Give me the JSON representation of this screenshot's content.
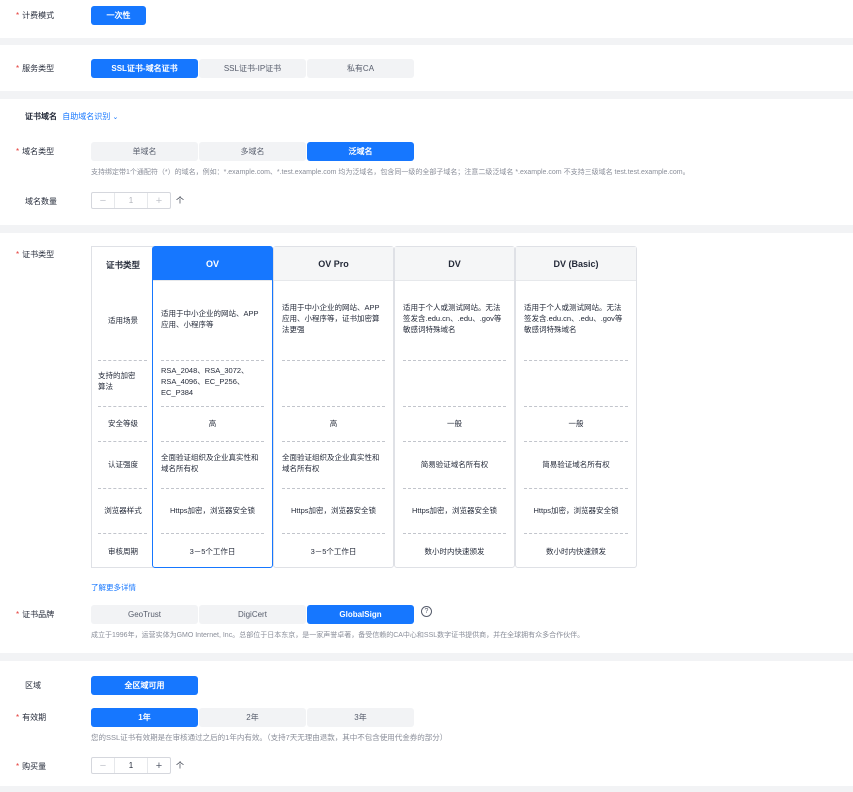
{
  "billing": {
    "label": "计费模式",
    "options": [
      "一次性"
    ]
  },
  "service": {
    "label": "服务类型",
    "options": [
      "SSL证书-域名证书",
      "SSL证书-IP证书",
      "私有CA"
    ]
  },
  "domain_section": {
    "title": "证书域名",
    "auto_link": "自助域名识别"
  },
  "domain_type": {
    "label": "域名类型",
    "options": [
      "单域名",
      "多域名",
      "泛域名"
    ],
    "hint": "支持绑定带1个通配符（*）的域名，例如：*.example.com、*.test.example.com 均为泛域名，包含同一级的全部子域名；注意二级泛域名 *.example.com 不支持三级域名 test.test.example.com。"
  },
  "domain_count": {
    "label": "域名数量",
    "value": "1",
    "unit": "个"
  },
  "cert_type": {
    "label": "证书类型",
    "header": "证书类型",
    "rows": [
      "适用场景",
      "支持的加密算法",
      "安全等级",
      "认证强度",
      "浏览器样式",
      "审核周期"
    ],
    "cards": [
      {
        "name": "OV",
        "scene": "适用于中小企业的网站、APP应用、小程序等",
        "algo": "RSA_2048、RSA_3072、RSA_4096、EC_P256、EC_P384",
        "level": "高",
        "auth": "全面验证组织及企业真实性和域名所有权",
        "browser": "Https加密，浏览器安全锁",
        "period": "3－5个工作日"
      },
      {
        "name": "OV Pro",
        "scene": "适用于中小企业的网站、APP应用、小程序等，证书加密算法更强",
        "algo": "",
        "level": "高",
        "auth": "全面验证组织及企业真实性和域名所有权",
        "browser": "Https加密，浏览器安全锁",
        "period": "3－5个工作日"
      },
      {
        "name": "DV",
        "scene": "适用于个人或测试网站。无法签发含.edu.cn、.edu、.gov等敏感词特殊域名",
        "algo": "",
        "level": "一般",
        "auth": "简易验证域名所有权",
        "browser": "Https加密，浏览器安全锁",
        "period": "数小时内快速颁发"
      },
      {
        "name": "DV (Basic)",
        "scene": "适用于个人或测试网站。无法签发含.edu.cn、.edu、.gov等敏感词特殊域名",
        "algo": "",
        "level": "一般",
        "auth": "简易验证域名所有权",
        "browser": "Https加密，浏览器安全锁",
        "period": "数小时内快速颁发"
      }
    ],
    "more_link": "了解更多详情"
  },
  "brand": {
    "label": "证书品牌",
    "options": [
      "GeoTrust",
      "DigiCert",
      "GlobalSign"
    ],
    "hint": "成立于1996年，运营实体为GMO Internet, Inc。总部位于日本东京，是一家声誉卓著，备受信赖的CA中心和SSL数字证书提供商，并在全球拥有众多合作伙伴。"
  },
  "region": {
    "label": "区域",
    "options": [
      "全区域可用"
    ]
  },
  "validity": {
    "label": "有效期",
    "options": [
      "1年",
      "2年",
      "3年"
    ],
    "hint": "您的SSL证书有效期是在审核通过之后的1年内有效。（支持7天无理由退款，其中不包含使用代金券的部分）"
  },
  "quantity": {
    "label": "购买量",
    "value": "1",
    "unit": "个"
  },
  "colors": {
    "primary": "#1677ff",
    "required": "#e53935",
    "muted": "#8a8e99"
  }
}
